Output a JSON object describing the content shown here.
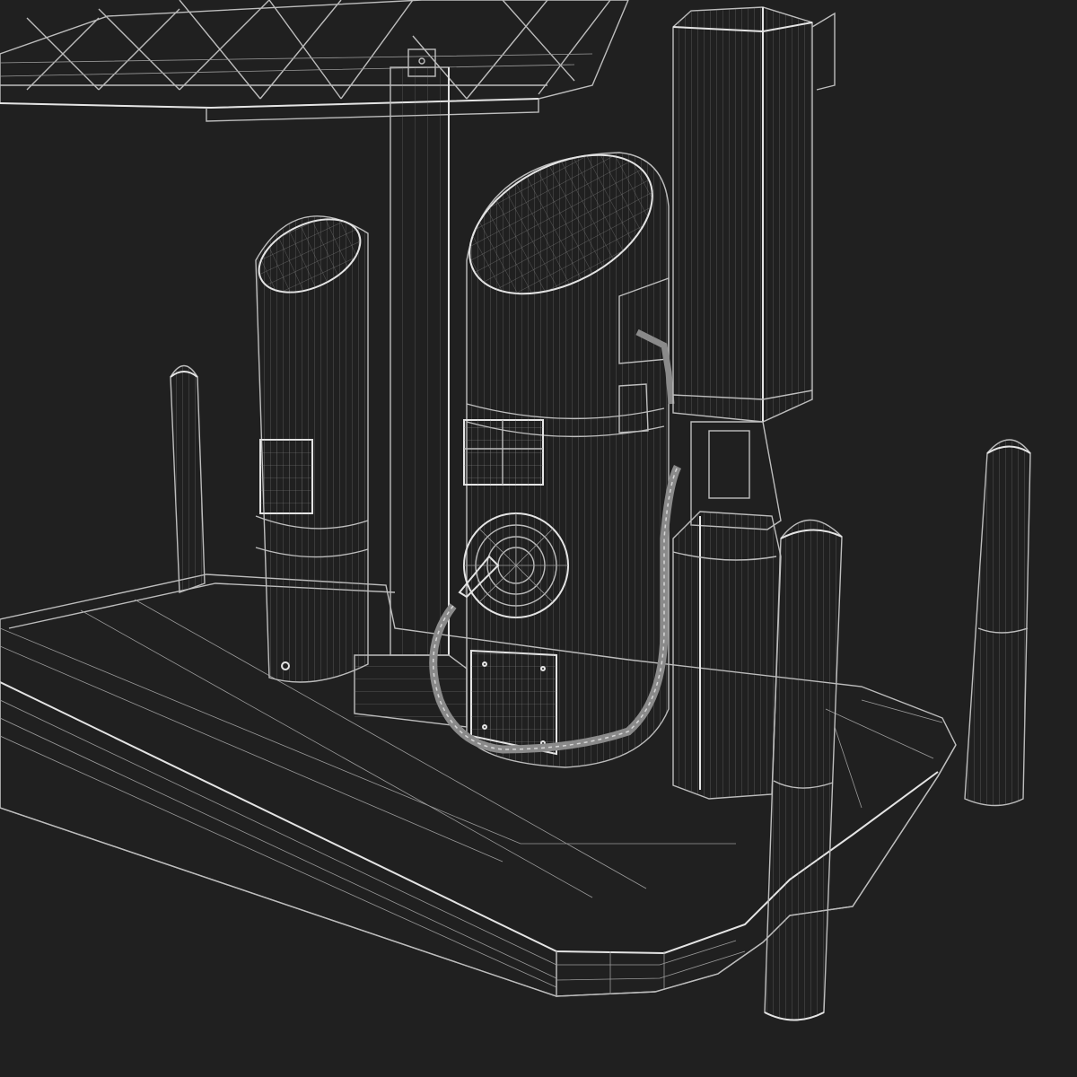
{
  "scene": {
    "background_color": "#202020",
    "wire_color": "#bdbdbd",
    "surface_color": "#3b3b3b",
    "surface_dark_color": "#2f2f2f",
    "objects": [
      "canopy-truss",
      "canopy-support-column",
      "service-island-base",
      "slanted-top-bollard",
      "ev-charger-unit",
      "charging-cable",
      "charging-connector",
      "info-display-panel",
      "tall-kiosk-column",
      "short-bollard-left",
      "short-bollard-right",
      "front-bollard"
    ]
  }
}
